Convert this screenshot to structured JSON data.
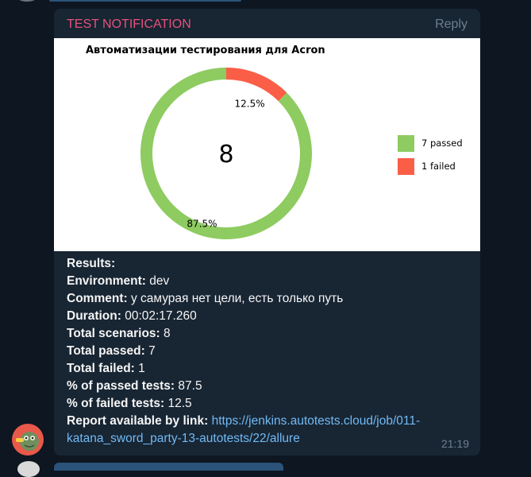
{
  "message": {
    "sender": "TEST NOTIFICATION",
    "reply_label": "Reply",
    "time": "21:19",
    "lines": [
      {
        "label": "Results:",
        "value": ""
      },
      {
        "label": "Environment:",
        "value": " dev"
      },
      {
        "label": "Comment:",
        "value": " у самурая нет цели, есть только путь"
      },
      {
        "label": "Duration:",
        "value": " 00:02:17.260"
      },
      {
        "label": "Total scenarios:",
        "value": " 8"
      },
      {
        "label": "Total passed:",
        "value": " 7"
      },
      {
        "label": "Total failed:",
        "value": " 1"
      },
      {
        "label": "% of passed tests:",
        "value": " 87.5"
      },
      {
        "label": "% of failed tests:",
        "value": " 12.5"
      }
    ],
    "report_label": "Report available by link:",
    "report_url": "https://jenkins.autotests.cloud/job/011-katana_sword_party-13-autotests/22/allure"
  },
  "chart_data": {
    "type": "pie",
    "title": "Автоматизации тестирования для Acron",
    "center_label": "8",
    "slices": [
      {
        "label": "7 passed",
        "value": 87.5,
        "display": "87.5%",
        "color": "#8ecb60"
      },
      {
        "label": "1 failed",
        "value": 12.5,
        "display": "12.5%",
        "color": "#fa5e47"
      }
    ],
    "legend_position": "right"
  },
  "icons": {
    "sender_avatar": "frog-avatar-icon"
  },
  "colors": {
    "background": "#0e1621",
    "bubble": "#182533",
    "sender": "#e5527a",
    "link": "#71baf5"
  }
}
